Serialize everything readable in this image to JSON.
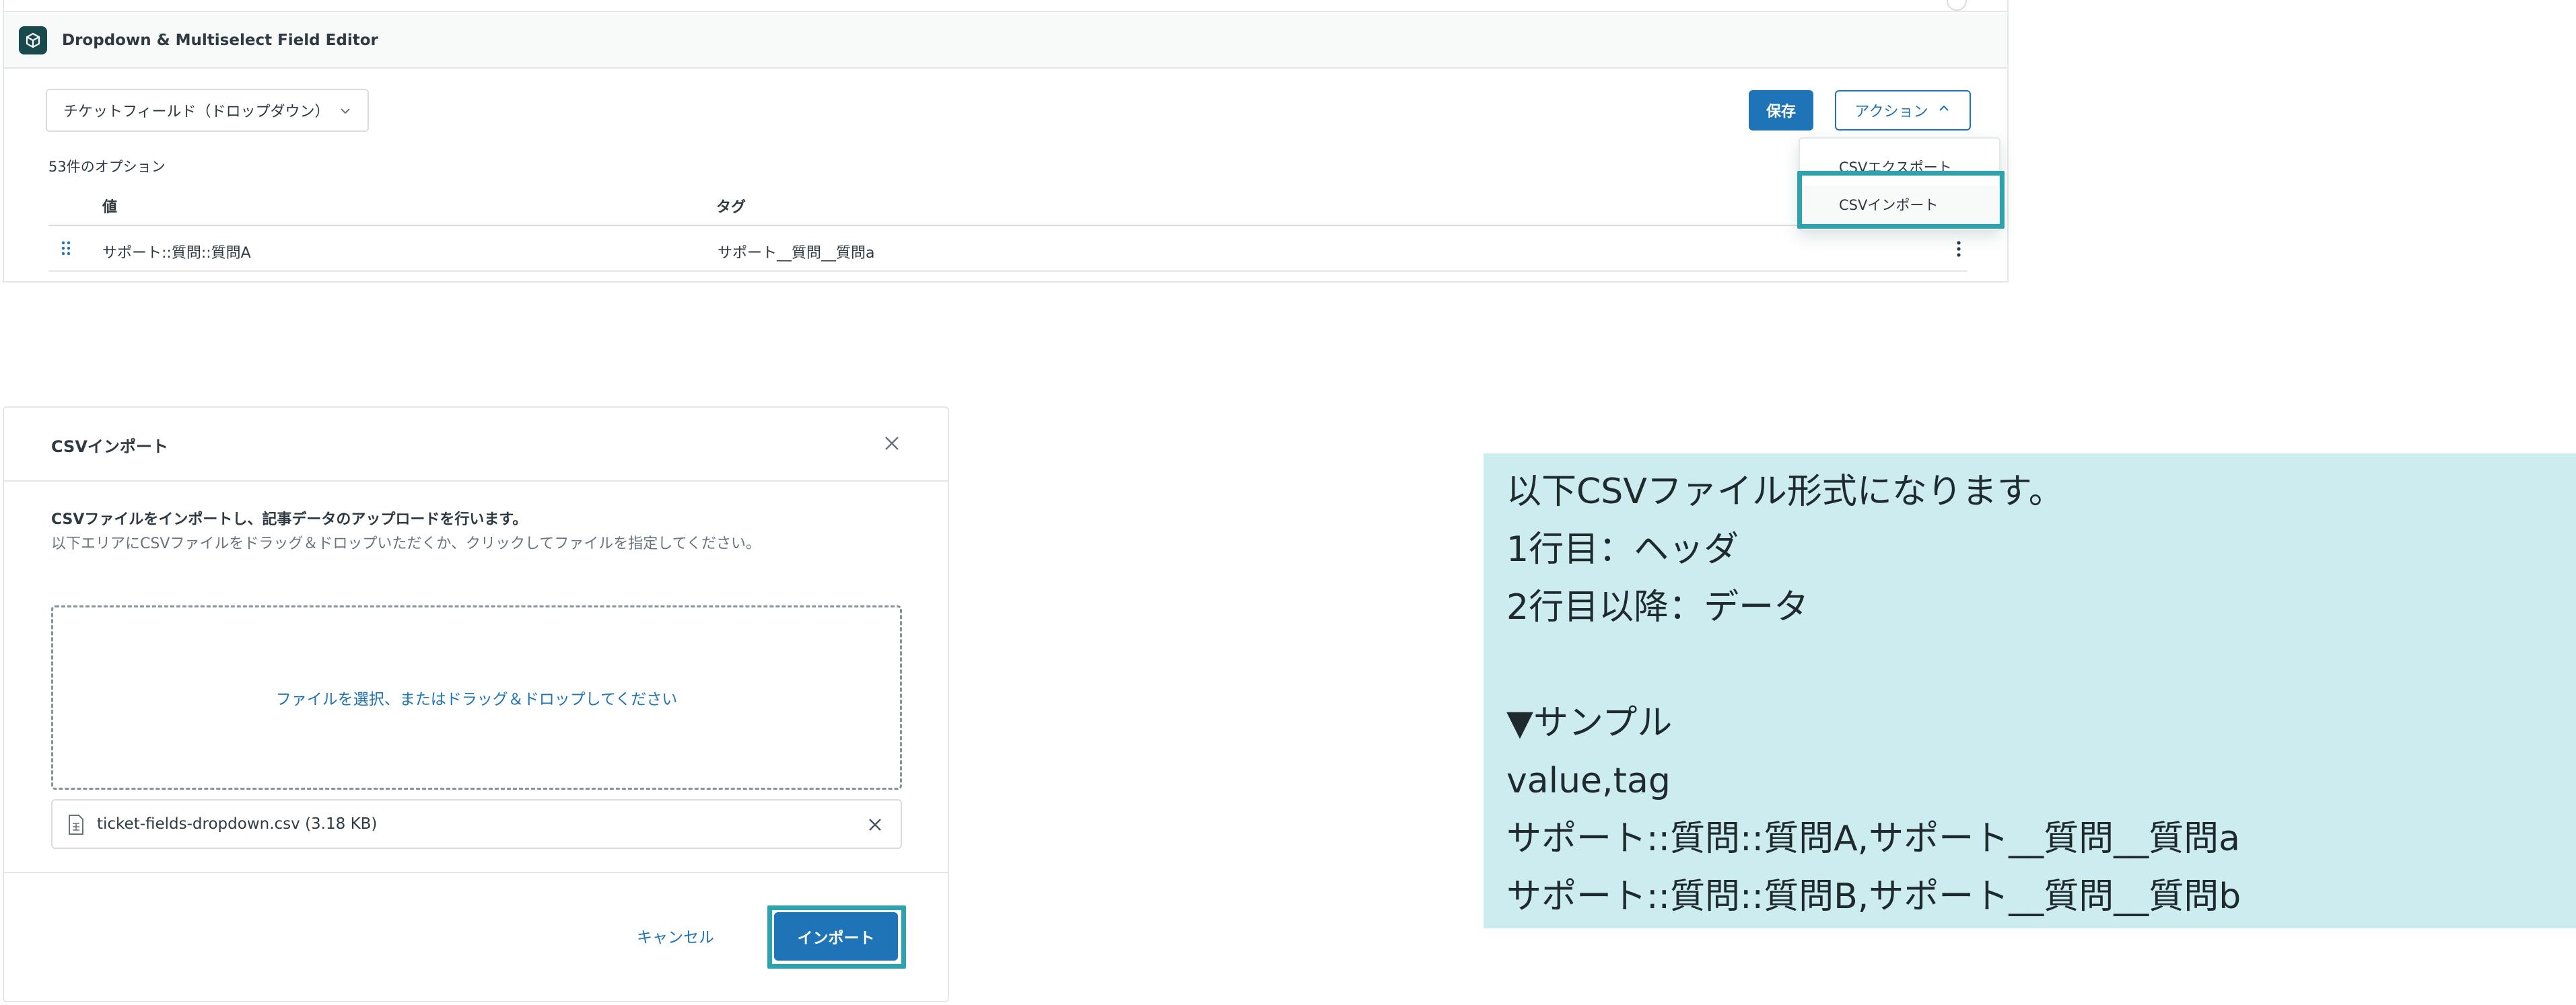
{
  "editor": {
    "app_title": "Dropdown & Multiselect Field Editor",
    "field_select_value": "チケットフィールド（ドロップダウン）",
    "save_label": "保存",
    "action_label": "アクション",
    "option_count": "53件のオプション",
    "columns": {
      "value": "値",
      "tag": "タグ"
    },
    "rows": [
      {
        "value": "サポート::質問::質問A",
        "tag": "サポート__質問__質問a"
      }
    ],
    "action_menu": {
      "export": "CSVエクスポート",
      "import": "CSVインポート"
    },
    "icons": [
      "app-icon",
      "chevron-down-icon",
      "chevron-up-icon",
      "drag-handle-icon",
      "more-vertical-icon"
    ]
  },
  "modal": {
    "title": "CSVインポート",
    "desc_strong": "CSVファイルをインポートし、記事データのアップロードを行います。",
    "desc": "以下エリアにCSVファイルをドラッグ＆ドロップいただくか、クリックしてファイルを指定してください。",
    "dropzone_text": "ファイルを選択、またはドラッグ＆ドロップしてください",
    "file_name": "ticket-fields-dropdown.csv (3.18 KB)",
    "cancel_label": "キャンセル",
    "import_label": "インポート",
    "icons": [
      "close-icon",
      "file-icon",
      "remove-file-icon"
    ]
  },
  "note": {
    "lines": [
      "以下CSVファイル形式になります。",
      "1行目：ヘッダ",
      "2行目以降：データ",
      "",
      "▼サンプル",
      "value,tag",
      "サポート::質問::質問A,サポート__質問__質問a",
      "サポート::質問::質問B,サポート__質問__質問b"
    ]
  },
  "colors": {
    "primary": "#1f73b7",
    "highlight": "#2ea3b0",
    "note_bg": "#cdecef",
    "app_icon_bg": "#17494d"
  }
}
